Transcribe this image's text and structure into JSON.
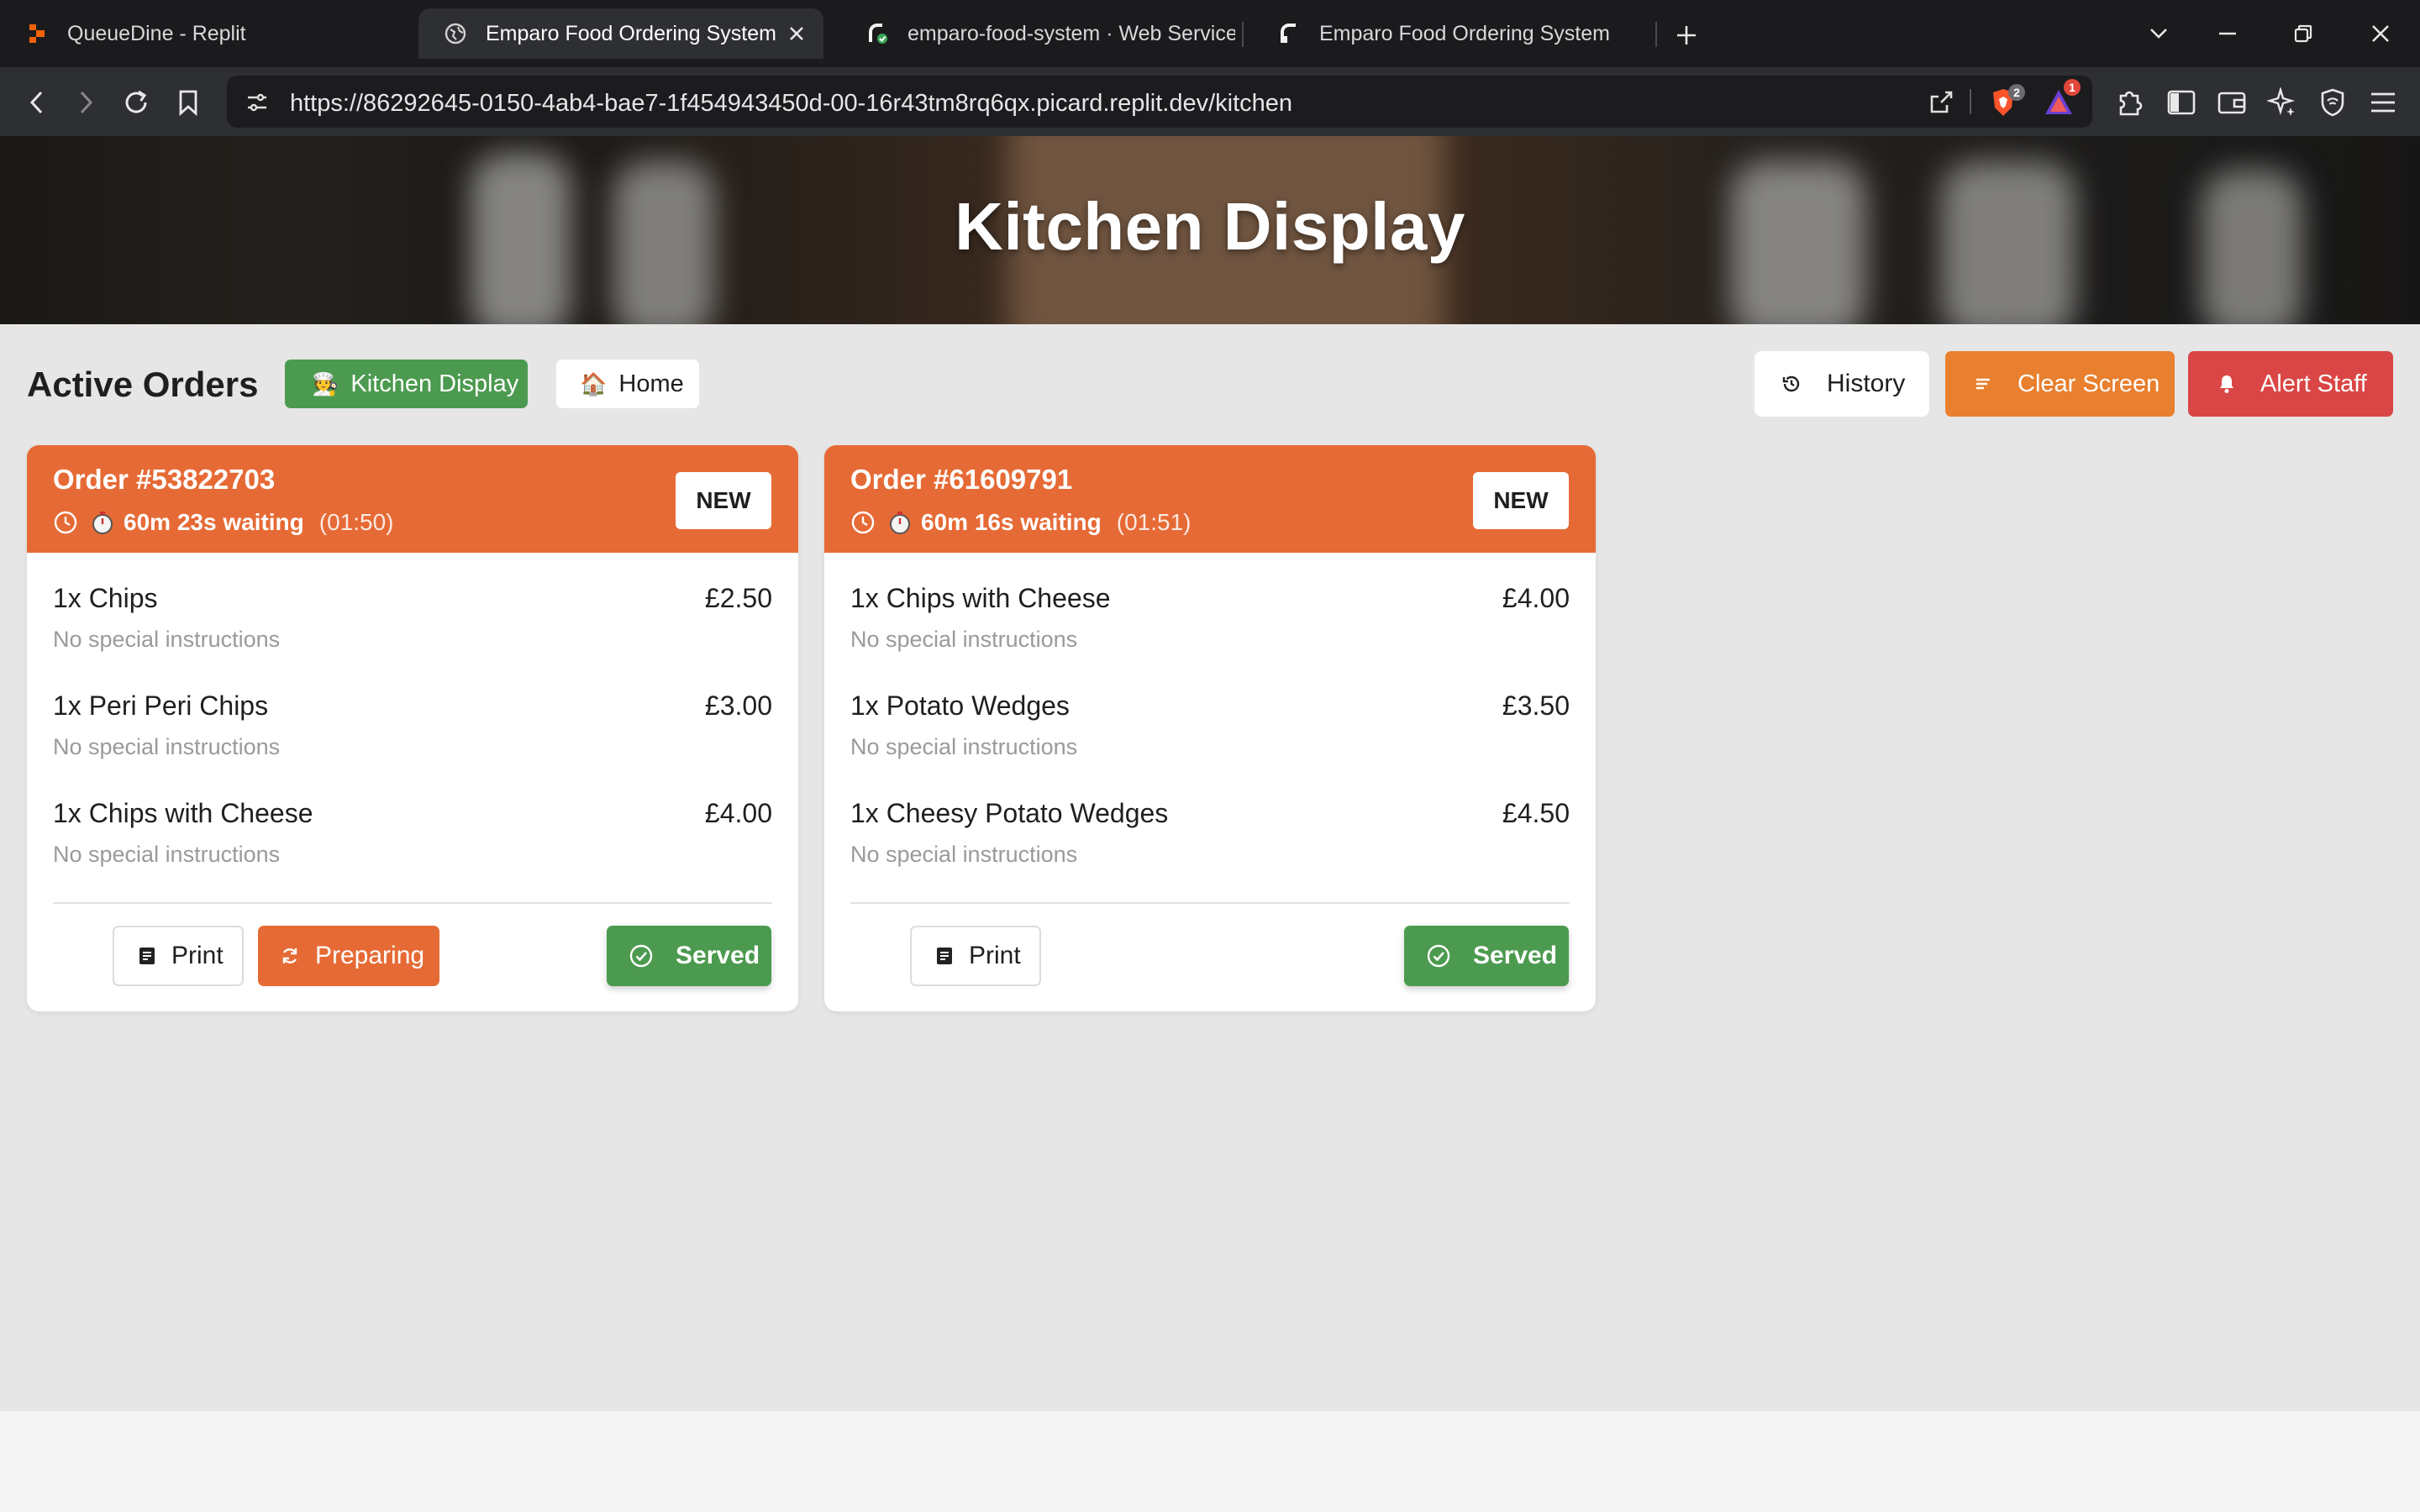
{
  "browser": {
    "tabs": [
      {
        "title": "QueueDine - Replit",
        "active": false
      },
      {
        "title": "Emparo Food Ordering System",
        "active": true
      },
      {
        "title": "emparo-food-system · Web Service ·",
        "active": false
      },
      {
        "title": "Emparo Food Ordering System",
        "active": false
      }
    ],
    "url": "https://86292645-0150-4ab4-bae7-1f454943450d-00-16r43tm8rq6qx.picard.replit.dev/kitchen",
    "brave_badge": "2",
    "rewards_badge": "1"
  },
  "page": {
    "hero_title": "Kitchen Display",
    "section_title": "Active Orders",
    "nav": {
      "kitchen_display": "Kitchen Display",
      "home": "Home"
    },
    "actions": {
      "history": "History",
      "clear_screen": "Clear Screen",
      "alert_staff": "Alert Staff"
    },
    "orders": [
      {
        "number": "Order #53822703",
        "waiting": "60m 23s waiting",
        "time": "(01:50)",
        "status": "NEW",
        "items": [
          {
            "name": "1x Chips",
            "price": "£2.50",
            "note": "No special instructions"
          },
          {
            "name": "1x Peri Peri Chips",
            "price": "£3.00",
            "note": "No special instructions"
          },
          {
            "name": "1x Chips with Cheese",
            "price": "£4.00",
            "note": "No special instructions"
          }
        ],
        "buttons": {
          "print": "Print",
          "preparing": "Preparing",
          "served": "Served"
        }
      },
      {
        "number": "Order #61609791",
        "waiting": "60m 16s waiting",
        "time": "(01:51)",
        "status": "NEW",
        "items": [
          {
            "name": "1x Chips with Cheese",
            "price": "£4.00",
            "note": "No special instructions"
          },
          {
            "name": "1x Potato Wedges",
            "price": "£3.50",
            "note": "No special instructions"
          },
          {
            "name": "1x Cheesy Potato Wedges",
            "price": "£4.50",
            "note": "No special instructions"
          }
        ],
        "buttons": {
          "print": "Print",
          "served": "Served"
        }
      }
    ]
  },
  "colors": {
    "accent_orange": "#e66a35",
    "clear_orange": "#e8802f",
    "success_green": "#4c9a4f",
    "alert_red": "#d94645"
  },
  "icons": {
    "history": "history-icon",
    "clear": "clear-lines-icon",
    "alert": "bell-icon",
    "print": "receipt-icon",
    "preparing": "refresh-icon",
    "served": "check-circle-icon",
    "clock": "clock-icon",
    "stopwatch": "stopwatch-icon"
  }
}
